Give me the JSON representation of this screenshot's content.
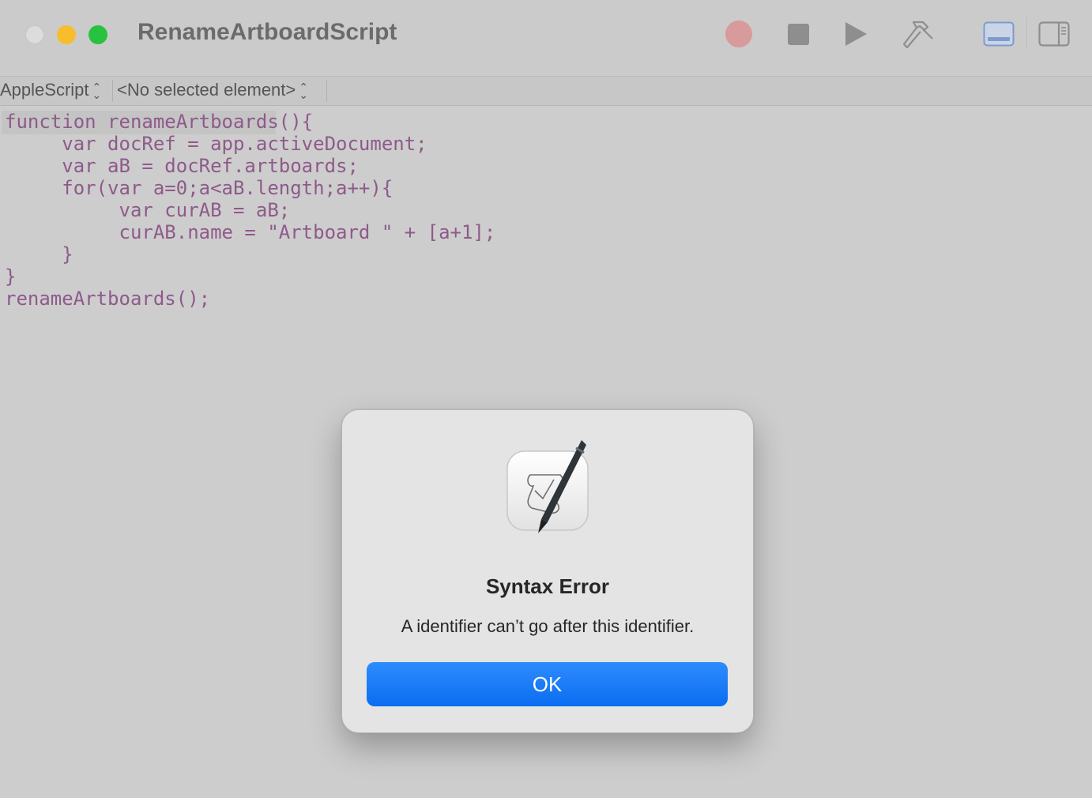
{
  "window": {
    "title": "RenameArtboardScript"
  },
  "toolbar": {
    "record_icon": "record-icon",
    "stop_icon": "stop-icon",
    "run_icon": "run-icon",
    "compile_icon": "hammer-icon",
    "log_panel_icon": "bottom-panel-icon",
    "inspector_icon": "sidebar-panel-icon",
    "record_color": "#d89a9a"
  },
  "navigator": {
    "language": "AppleScript",
    "element": "<No selected element>"
  },
  "editor": {
    "text_color": "#8e5a8a",
    "lines": [
      "function renameArtboards(){",
      "     var docRef = app.activeDocument;",
      "     var aB = docRef.artboards;",
      "     for(var a=0;a<aB.length;a++){",
      "          var curAB = aB;",
      "          curAB.name = \"Artboard \" + [a+1];",
      "     }",
      "}",
      "renameArtboards();"
    ]
  },
  "dialog": {
    "icon": "script-editor-app-icon",
    "title": "Syntax Error",
    "message": "A identifier can’t go after this identifier.",
    "ok_label": "OK",
    "button_color": "#0a6df0"
  }
}
